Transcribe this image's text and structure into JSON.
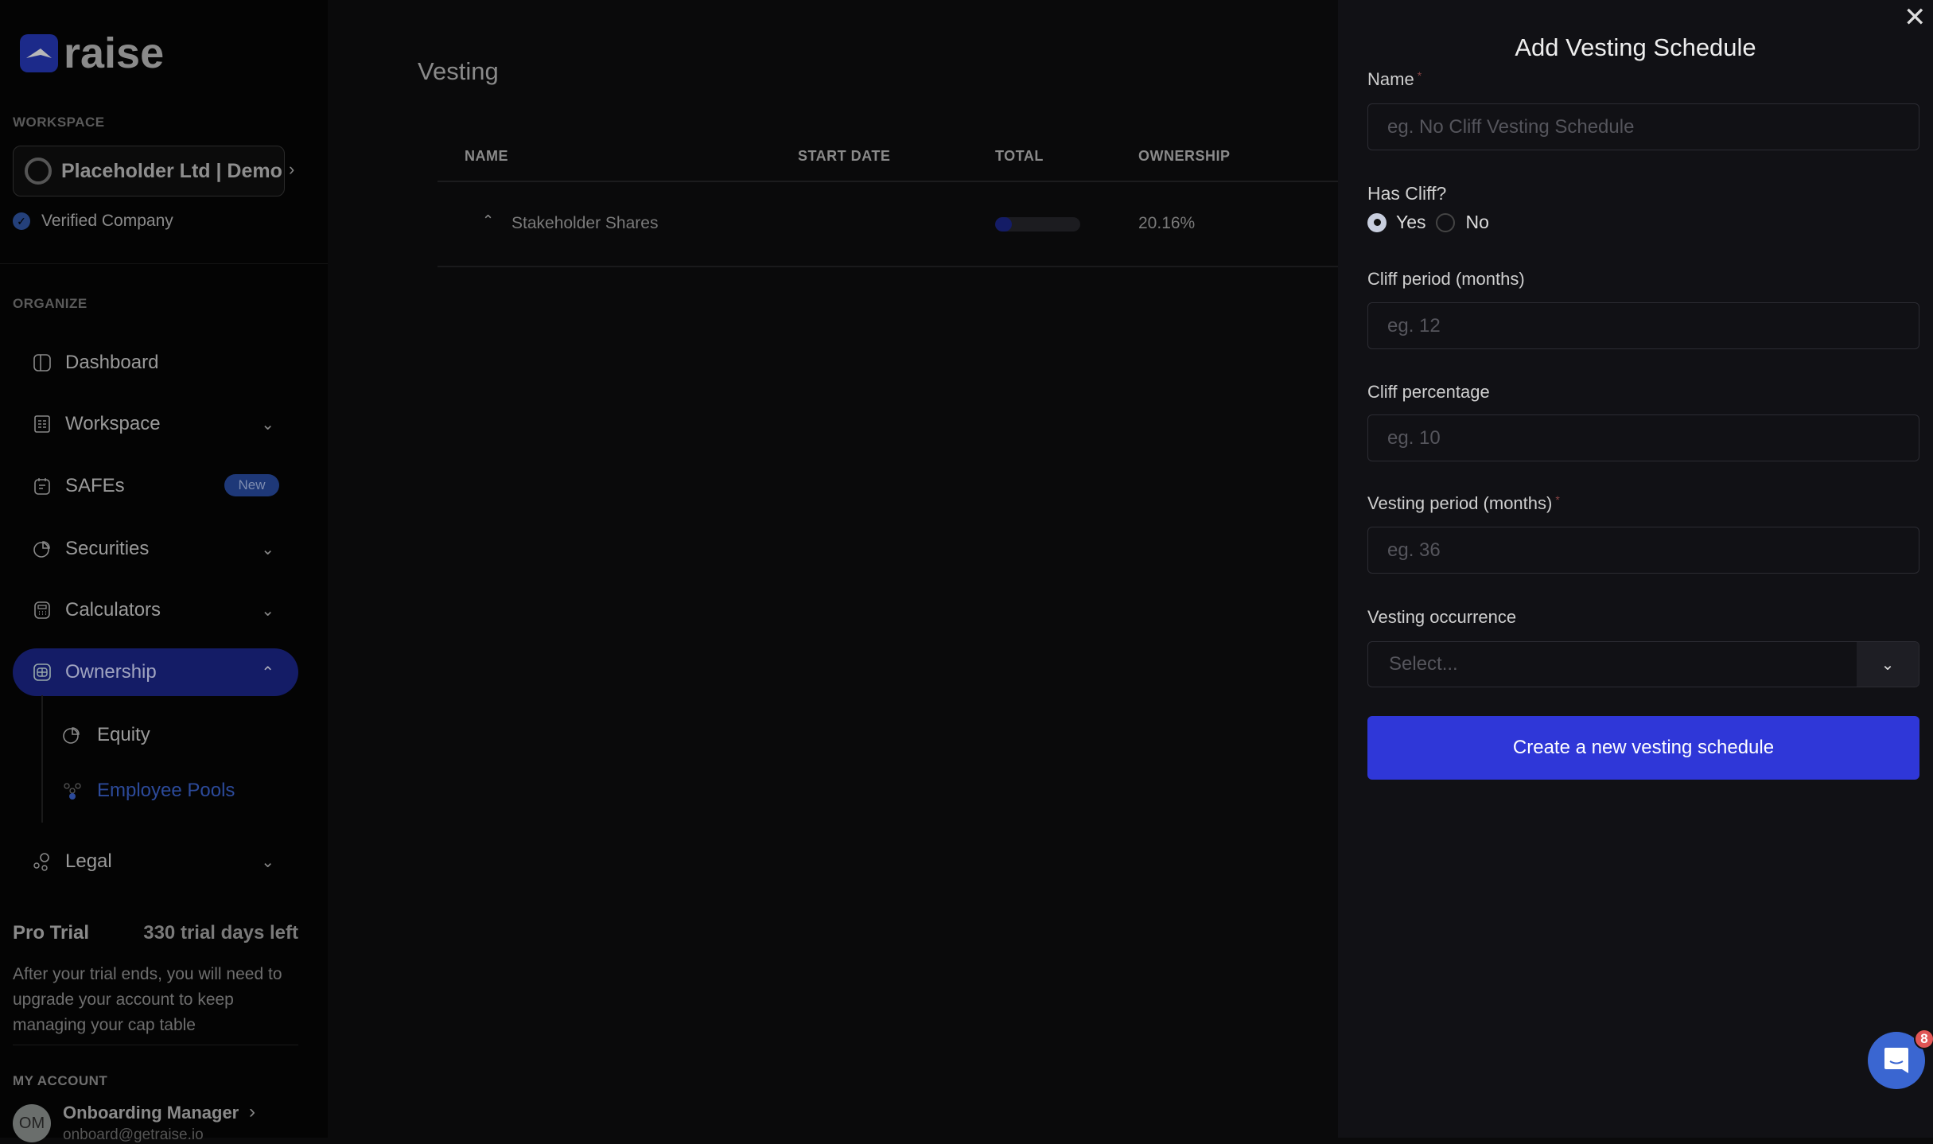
{
  "brand": {
    "name": "raise"
  },
  "sidebar": {
    "workspace_label": "WORKSPACE",
    "company": "Placeholder Ltd | Demo",
    "verified": "Verified Company",
    "organize_label": "ORGANIZE",
    "items": [
      {
        "label": "Dashboard",
        "icon": "dashboard-icon"
      },
      {
        "label": "Workspace",
        "icon": "workspace-icon"
      },
      {
        "label": "SAFEs",
        "icon": "safes-icon",
        "badge": "New"
      },
      {
        "label": "Securities",
        "icon": "pie-icon"
      },
      {
        "label": "Calculators",
        "icon": "calculator-icon"
      },
      {
        "label": "Ownership",
        "icon": "ownership-icon",
        "active": true
      },
      {
        "label": "Legal",
        "icon": "legal-icon"
      }
    ],
    "subitems": [
      {
        "label": "Equity"
      },
      {
        "label": "Employee Pools",
        "active": true
      }
    ],
    "trial": {
      "title": "Pro Trial",
      "days": "330 trial days left",
      "note": "After your trial ends, you will need to upgrade your account to keep managing your cap table"
    },
    "account_label": "MY ACCOUNT",
    "user": {
      "initials": "OM",
      "name": "Onboarding Manager",
      "email": "onboard@getraise.io"
    }
  },
  "main": {
    "title": "Vesting",
    "columns": [
      "NAME",
      "START DATE",
      "TOTAL",
      "OWNERSHIP"
    ],
    "rows": [
      {
        "name": "Stakeholder Shares",
        "start_date": "",
        "total_progress": 0.2,
        "ownership": "20.16%"
      }
    ]
  },
  "panel": {
    "title": "Add Vesting Schedule",
    "name_label": "Name",
    "name_placeholder": "eg. No Cliff Vesting Schedule",
    "cliff_label": "Has Cliff?",
    "yes": "Yes",
    "no": "No",
    "cliff_selected": "Yes",
    "cliff_period_label": "Cliff period (months)",
    "cliff_period_placeholder": "eg. 12",
    "cliff_pct_label": "Cliff percentage",
    "cliff_pct_placeholder": "eg. 10",
    "vesting_period_label": "Vesting period (months)",
    "vesting_period_placeholder": "eg. 36",
    "occurrence_label": "Vesting occurrence",
    "occurrence_placeholder": "Select...",
    "submit": "Create a new vesting schedule",
    "required_mark": "*"
  },
  "chat": {
    "badge": "8"
  },
  "colors": {
    "accent": "#2f37d8",
    "active_nav": "#141c66",
    "badge": "#e05555",
    "chat": "#3a66d1"
  }
}
